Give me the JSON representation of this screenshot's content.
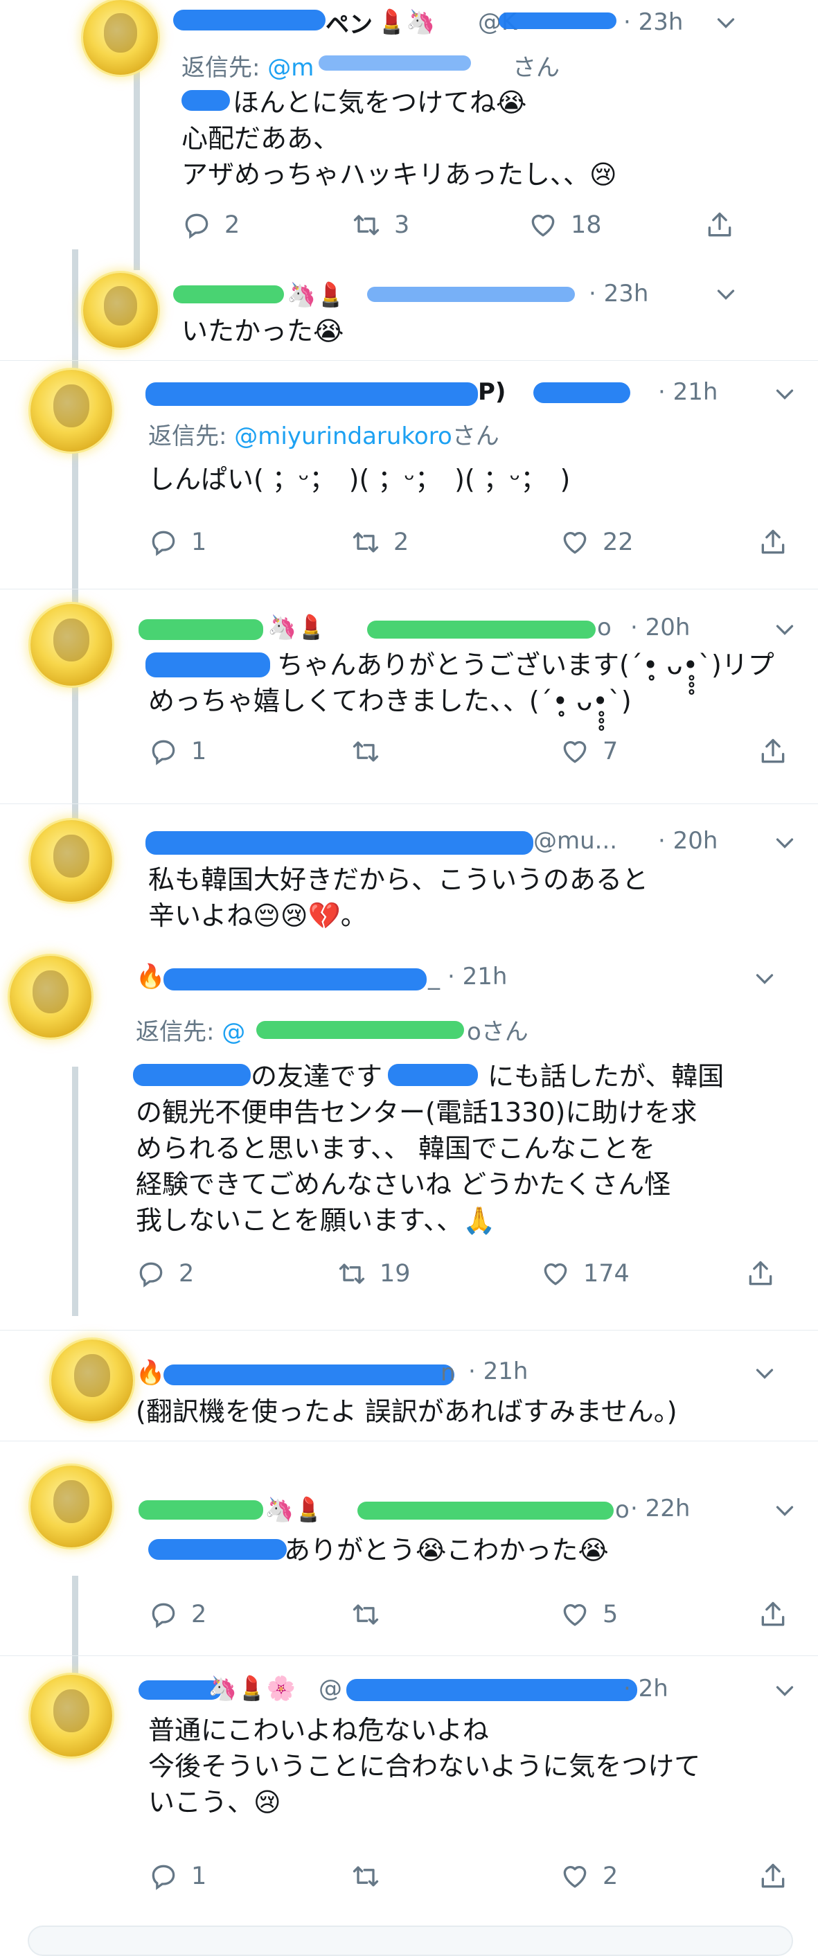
{
  "tweets": [
    {
      "name_suffix": "ペン",
      "emoji": "💄🦄",
      "handle": "@K",
      "time": "23h",
      "reply_to_label": "返信先:",
      "reply_to_handle": "@m",
      "reply_to_suffix": "さん",
      "text": "ほんとに気をつけてね😭\n心配だああ、\nアザめっちゃハッキリあったし、、😢",
      "replies": "2",
      "retweets": "3",
      "likes": "18"
    },
    {
      "emoji": "🦄💄",
      "time": "23h",
      "text": "いたかった😭"
    },
    {
      "name_suffix": "P)",
      "time": "21h",
      "reply_to_label": "返信先:",
      "reply_to_handle": "@miyurindarukoro",
      "reply_to_suffix": "さん",
      "text": "しんぱい( ；ᵕ；　)( ；ᵕ；　)( ；ᵕ；　)",
      "replies": "1",
      "retweets": "2",
      "likes": "22"
    },
    {
      "emoji": "🦄💄",
      "handle_suffix": "o",
      "time": "20h",
      "text": "ちゃんありがとうございます(´•̥̥̥ ᴗ•̥̥̥`)リプめっちゃ嬉しくてわきました、、(´•̥̥̥ ᴗ•̥̥̥`)",
      "replies": "1",
      "retweets": "",
      "likes": "7"
    },
    {
      "handle": "@mu...",
      "time": "20h",
      "text": "私も韓国大好きだから、こういうのあると\n辛いよね😔😢💔。"
    },
    {
      "emoji": "🔥",
      "name_suffix": "_",
      "time": "21h",
      "reply_to_label": "返信先:",
      "reply_to_handle": "@",
      "reply_to_suffix": "oさん",
      "text": "の友達です　　　　にも話したが、韓国\nの観光不便申告センター(電話1330)に助けを求\nめられると思います、、 韓国でこんなことを\n経験できてごめんなさいね どうかたくさん怪\n我しないことを願います、、🙏",
      "replies": "2",
      "retweets": "19",
      "likes": "174"
    },
    {
      "emoji": "🔥",
      "name_suffix": "n",
      "time": "21h",
      "text": "(翻訳機を使ったよ 誤訳があればすみません。)"
    },
    {
      "emoji": "🦄💄",
      "handle_suffix": "o",
      "time": "22h",
      "text": "ありがとう😭こわかった😭",
      "replies": "2",
      "retweets": "",
      "likes": "5"
    },
    {
      "emoji": "🦄💄🌸",
      "handle": "@",
      "time": "2h",
      "text": "普通にこわいよね危ないよね\n今後そういうことに合わないように気をつけて\nいこう、😢",
      "replies": "1",
      "retweets": "",
      "likes": "2"
    }
  ],
  "icons": {
    "reply": "reply-icon",
    "retweet": "retweet-icon",
    "like": "heart-icon",
    "share": "share-icon",
    "more": "chevron-down-icon"
  },
  "colors": {
    "link": "#1da1f2",
    "muted": "#657786",
    "text": "#14171a",
    "divider": "#e6ecf0"
  }
}
